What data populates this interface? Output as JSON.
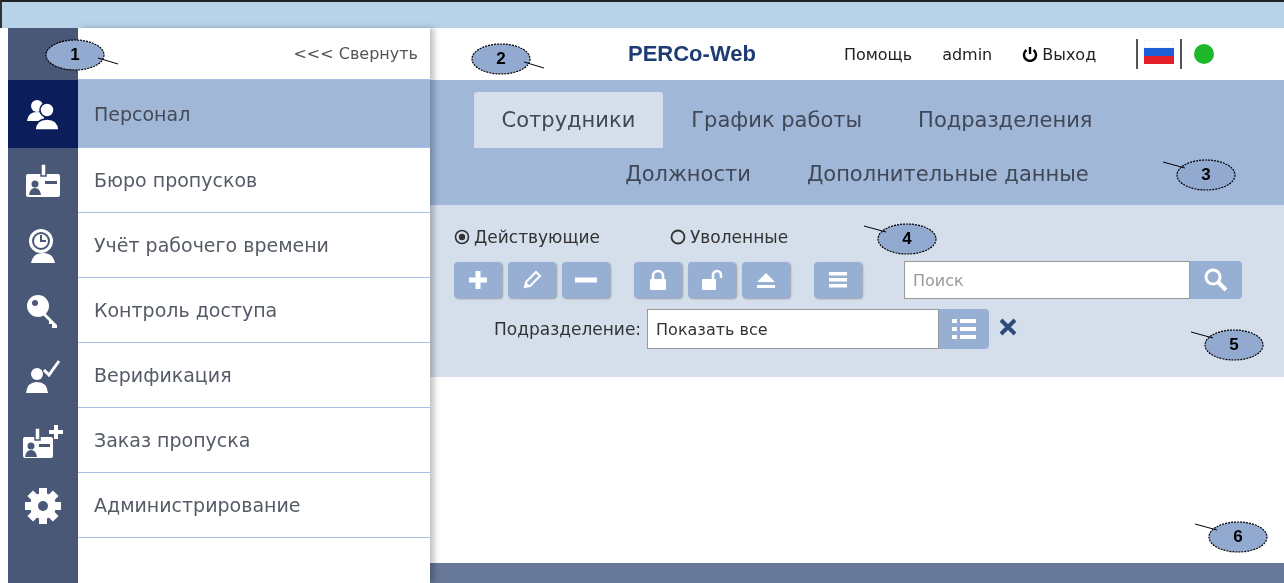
{
  "sidebar": {
    "collapse_link": "<<< Свернуть",
    "items": [
      {
        "label": "Персонал",
        "selected": true
      },
      {
        "label": "Бюро пропусков",
        "selected": false
      },
      {
        "label": "Учёт рабочего времени",
        "selected": false
      },
      {
        "label": "Контроль доступа",
        "selected": false
      },
      {
        "label": "Верификация",
        "selected": false
      },
      {
        "label": "Заказ пропуска",
        "selected": false
      },
      {
        "label": "Администрирование",
        "selected": false
      }
    ]
  },
  "header": {
    "logo": "PERCo-Web",
    "help": "Помощь",
    "user": "admin",
    "logout": "Выход",
    "online": true
  },
  "tab_rows": [
    {
      "tabs": [
        {
          "label": "Сотрудники",
          "selected": true
        },
        {
          "label": "График работы",
          "selected": false
        },
        {
          "label": "Подразделения",
          "selected": false
        }
      ]
    },
    {
      "tabs": [
        {
          "label": "Должности",
          "selected": false
        },
        {
          "label": "Дополнительные данные",
          "selected": false
        }
      ]
    }
  ],
  "status_filter": [
    {
      "label": "Действующие",
      "selected": true
    },
    {
      "label": "Уволенные",
      "selected": false
    }
  ],
  "search": {
    "placeholder": "Поиск"
  },
  "department_filter": {
    "label": "Подразделение:",
    "value": "Показать все"
  },
  "callouts": [
    {
      "label": "1"
    },
    {
      "label": "2"
    },
    {
      "label": "3"
    },
    {
      "label": "4"
    },
    {
      "label": "5"
    },
    {
      "label": "6"
    }
  ]
}
